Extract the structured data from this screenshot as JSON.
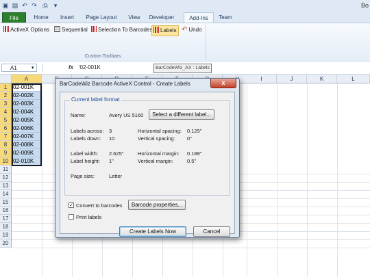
{
  "titlebar": {
    "right_fragment": "Bo"
  },
  "ribbon": {
    "tabs": [
      {
        "label": "File"
      },
      {
        "label": "Home"
      },
      {
        "label": "Insert"
      },
      {
        "label": "Page Layout"
      },
      {
        "label": "View"
      },
      {
        "label": "Developer"
      },
      {
        "label": "Add-Ins"
      },
      {
        "label": "Team"
      }
    ],
    "active_tab": "Add-Ins",
    "toolbar": [
      {
        "label": "ActiveX Options",
        "icon": "barcode-icon"
      },
      {
        "label": "Sequential",
        "icon": "sequential-icon"
      },
      {
        "label": "Selection To Barcodes",
        "icon": "barcode-icon"
      },
      {
        "label": "Labels",
        "icon": "barcode-icon"
      },
      {
        "label": "Undo",
        "icon": "undo-icon"
      }
    ],
    "group_label": "Custom Toolbars"
  },
  "formula_bar": {
    "name_box": "A1",
    "fx": "fx",
    "value": "'02-001K",
    "tooltip": "BarCodeWiz_AX : Labels"
  },
  "sheet": {
    "columns": [
      "A",
      "B",
      "C",
      "D",
      "E",
      "F",
      "G",
      "H",
      "I",
      "J",
      "K",
      "L"
    ],
    "rows": [
      "1",
      "2",
      "3",
      "4",
      "5",
      "6",
      "7",
      "8",
      "9",
      "10",
      "11",
      "12",
      "13",
      "14",
      "15",
      "16",
      "17",
      "18",
      "19",
      "20"
    ],
    "column_a": [
      "02-001K",
      "02-002K",
      "02-003K",
      "02-004K",
      "02-005K",
      "02-006K",
      "02-007K",
      "02-008K",
      "02-009K",
      "02-010K"
    ]
  },
  "dialog": {
    "title": "BarCodeWiz Barcode ActiveX Control - Create Labels",
    "close": "x",
    "group_title": "Current label format",
    "name_label": "Name:",
    "name_value": "Avery US 5160",
    "select_button": "Select a different label...",
    "labels_across_label": "Labels across:",
    "labels_across": "3",
    "labels_down_label": "Labels down:",
    "labels_down": "10",
    "h_spacing_label": "Horizontal spacing:",
    "h_spacing": "0.125\"",
    "v_spacing_label": "Vertical spacing:",
    "v_spacing": "0\"",
    "label_width_label": "Label width:",
    "label_width": "2.625\"",
    "label_height_label": "Label height:",
    "label_height": "1\"",
    "h_margin_label": "Horizontal margin:",
    "h_margin": "0.188\"",
    "v_margin_label": "Vertical margin:",
    "v_margin": "0.5\"",
    "page_size_label": "Page size:",
    "page_size": "Letter",
    "convert_label": "Convert to barcodes",
    "convert_checked": true,
    "barcode_props_button": "Barcode properties...",
    "print_labels_label": "Print labels",
    "print_labels_checked": false,
    "create_button": "Create Labels Now",
    "cancel_button": "Cancel"
  }
}
